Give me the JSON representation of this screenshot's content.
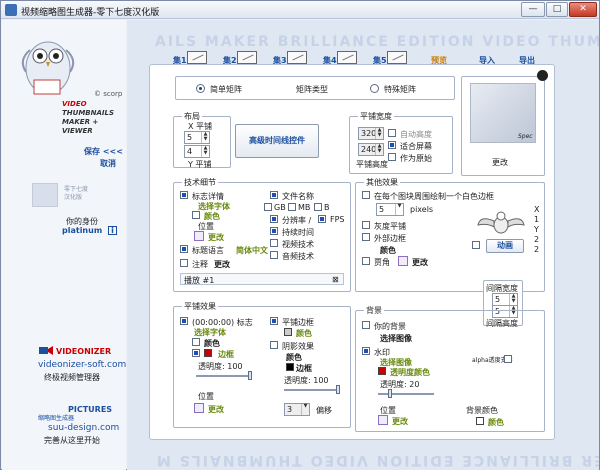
{
  "window": {
    "title": "视频缩略图生成器-零下七度汉化版",
    "min": "—",
    "max": "□",
    "close": "✕"
  },
  "left": {
    "corp": "© scorp",
    "brand": [
      "VIDEO",
      "THUMBNAILS",
      "MAKER + VIEWER"
    ],
    "save": "保存 <<<",
    "cancel": "取消",
    "watermark_text": "零下七度\n汉化版",
    "identity_label": "你的身份",
    "identity_value": "platinum",
    "info": "i",
    "videonizer": "VIDEONIZER",
    "videonizer_url": "videonizer-soft.com",
    "videonizer_desc": "终极视频管理器",
    "pictures": "PICTURES",
    "pictures_sub": "缩略图生成器",
    "pictures_url": "suu-design.com",
    "pictures_desc": "完善从这里开始"
  },
  "steps": [
    "集1",
    "集2",
    "集3",
    "集4",
    "集5",
    "预览",
    "导入",
    "导出"
  ],
  "watermark": "AILS MAKER BRILLIANCE EDITION VIDEO THUMBNAILS M",
  "rect_type": {
    "simple": "简单矩阵",
    "label": "矩阵类型",
    "special": "特殊矩阵"
  },
  "layout": {
    "title": "布局",
    "x_label": "X 平铺",
    "y_label": "Y 平铺",
    "x": "5",
    "y": "4",
    "advanced": "高级时间线控件"
  },
  "tile_size": {
    "title": "平铺宽度",
    "width": "320",
    "height": "240",
    "height_label": "平铺高度",
    "auto_height": "自动高度",
    "fit_screen": "适合屏幕",
    "as_original": "作为原始"
  },
  "preview": {
    "label": "Spec",
    "change": "更改"
  },
  "tech": {
    "title": "技术细节",
    "logo_detail": "标志详情",
    "choose_font": "选择字体",
    "color": "颜色",
    "position": "位置",
    "change": "更改",
    "title_lang": "标题语言",
    "lang_value": "简体中文",
    "note": "注释",
    "note_change": "更改",
    "slot": "播放 #1",
    "filename": "文件名称",
    "gb": "GB",
    "mb": "MB",
    "b": "B",
    "resolution": "分辨率 /",
    "fps": "FPS",
    "duration": "持续时间",
    "video_tech": "视频技术",
    "audio_tech": "音频技术"
  },
  "other": {
    "title": "其他效果",
    "border_text": "在每个图块周围绘制一个白色边框",
    "pixels": "pixels",
    "border_value": "5",
    "grayscale": "灰度平铺",
    "outer_border": "外部边框",
    "color": "颜色",
    "bezel": "贾角",
    "change": "更改",
    "animate": "动画",
    "x_label": "X",
    "y_label": "Y",
    "coords": [
      "1",
      "2",
      "2"
    ]
  },
  "gap": {
    "width_label": "间隔宽度",
    "height_label": "间隔高度",
    "width": "5",
    "height": "5"
  },
  "tile_effects": {
    "title": "平铺效果",
    "logo": "(00:00:00) 标志",
    "choose_font": "选择字体",
    "color": "颜色",
    "border": "边框",
    "opacity": "透明度: 100",
    "position": "位置",
    "change": "更改",
    "tile_border": "平铺边框",
    "tile_border_color": "颜色",
    "shadow": "阴影效果",
    "shadow_color": "颜色",
    "shadow_border": "边框",
    "shadow_opacity": "透明度: 100",
    "offset_value": "3",
    "offset": "偏移"
  },
  "background": {
    "title": "背景",
    "your_bg": "你的背景",
    "choose_image": "选择图像",
    "watermark": "水印",
    "wm_image": "选择图像",
    "wm_opacity_color": "透明度颜色",
    "opacity": "透明度: 20",
    "position": "位置",
    "change": "更改",
    "alpha": "alpha透度支持",
    "bg_color": "背景颜色",
    "color": "颜色"
  },
  "colors": {
    "accent": "#1b4fa0",
    "olive": "#6a8a10",
    "red": "#c00000",
    "checked": "#1d4fb5"
  }
}
